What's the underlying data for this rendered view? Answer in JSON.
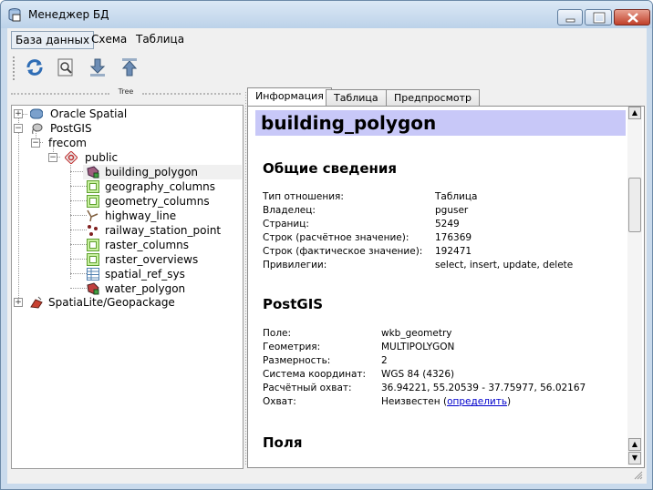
{
  "window": {
    "title": "Менеджер БД"
  },
  "menu": [
    "База данных",
    "Схема",
    "Таблица"
  ],
  "toolbar": {
    "icons": [
      "refresh-icon",
      "sql-window-icon",
      "import-icon",
      "export-icon"
    ]
  },
  "dock": {
    "title": "Tree"
  },
  "tree": {
    "oracle": "Oracle Spatial",
    "postgis": "PostGIS",
    "db": "frecom",
    "schema": "public",
    "tables": [
      "building_polygon",
      "geography_columns",
      "geometry_columns",
      "highway_line",
      "railway_station_point",
      "raster_columns",
      "raster_overviews",
      "spatial_ref_sys",
      "water_polygon"
    ],
    "spatialite": "SpatiaLite/Geopackage"
  },
  "tabs": [
    "Информация",
    "Таблица",
    "Предпросмотр"
  ],
  "info": {
    "title": "building_polygon",
    "general_heading": "Общие сведения",
    "general": [
      {
        "k": "Тип отношения:",
        "v": "Таблица"
      },
      {
        "k": "Владелец:",
        "v": "pguser"
      },
      {
        "k": "Страниц:",
        "v": "5249"
      },
      {
        "k": "Строк (расчётное значение):",
        "v": "176369"
      },
      {
        "k": "Строк (фактическое значение):",
        "v": "192471"
      },
      {
        "k": "Привилегии:",
        "v": "select, insert, update, delete"
      }
    ],
    "postgis_heading": "PostGIS",
    "postgis": [
      {
        "k": "Поле:",
        "v": "wkb_geometry"
      },
      {
        "k": "Геометрия:",
        "v": "MULTIPOLYGON"
      },
      {
        "k": "Размерность:",
        "v": "2"
      },
      {
        "k": "Система координат:",
        "v": "WGS 84 (4326)"
      },
      {
        "k": "Расчётный охват:",
        "v": "36.94221, 55.20539 - 37.75977, 56.02167"
      }
    ],
    "extent_label": "Охват:",
    "extent_value": "Неизвестен (",
    "extent_link": "определить",
    "extent_close": ")",
    "fields_heading": "Поля"
  }
}
